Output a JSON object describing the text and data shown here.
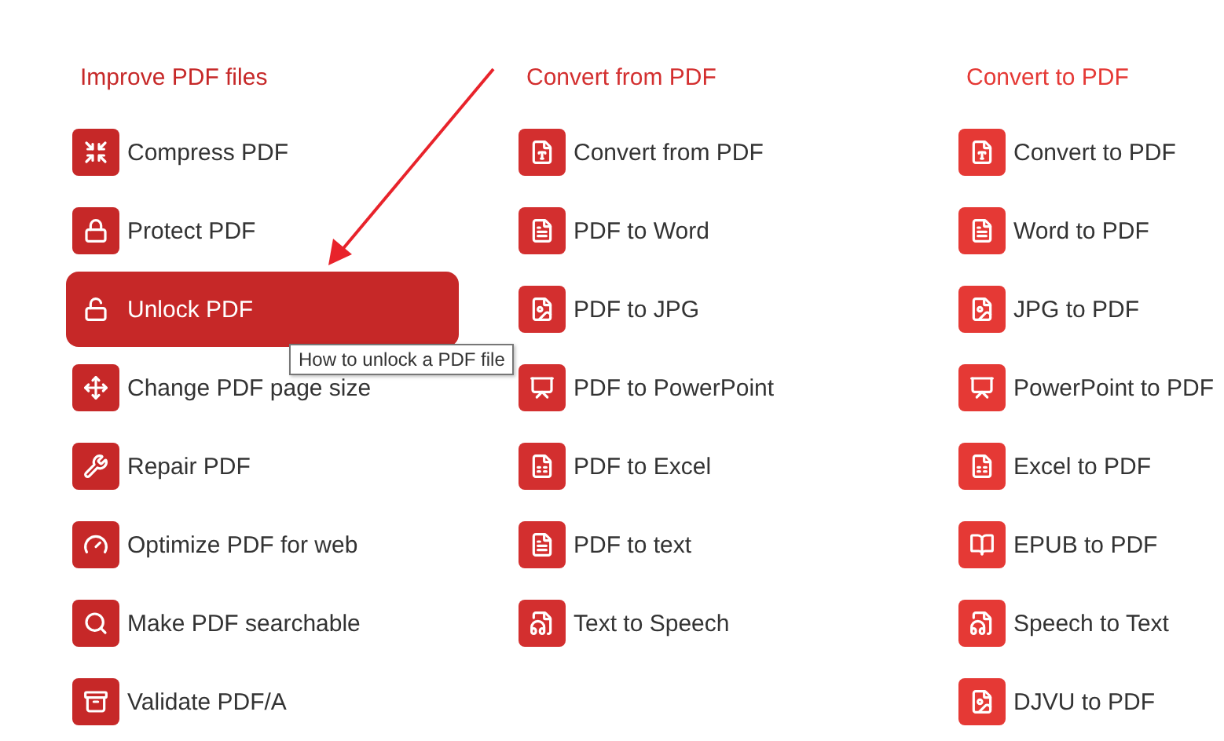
{
  "columns": [
    {
      "heading": "Improve PDF files",
      "color": "#c62828",
      "items": [
        {
          "label": "Compress PDF",
          "kind": "compress",
          "selected": false
        },
        {
          "label": "Protect PDF",
          "kind": "lock",
          "selected": false
        },
        {
          "label": "Unlock PDF",
          "kind": "unlock",
          "selected": true,
          "tooltip": "How to unlock a PDF file"
        },
        {
          "label": "Change PDF page size",
          "kind": "move",
          "selected": false
        },
        {
          "label": "Repair PDF",
          "kind": "wrench",
          "selected": false
        },
        {
          "label": "Optimize PDF for web",
          "kind": "gauge",
          "selected": false
        },
        {
          "label": "Make PDF searchable",
          "kind": "search",
          "selected": false
        },
        {
          "label": "Validate PDF/A",
          "kind": "archive",
          "selected": false
        }
      ]
    },
    {
      "heading": "Convert from PDF",
      "color": "#d32f2f",
      "items": [
        {
          "label": "Convert from PDF",
          "kind": "pdf",
          "selected": false
        },
        {
          "label": "PDF to Word",
          "kind": "word",
          "selected": false
        },
        {
          "label": "PDF to JPG",
          "kind": "image",
          "selected": false
        },
        {
          "label": "PDF to PowerPoint",
          "kind": "slides",
          "selected": false
        },
        {
          "label": "PDF to Excel",
          "kind": "sheet",
          "selected": false
        },
        {
          "label": "PDF to text",
          "kind": "text",
          "selected": false
        },
        {
          "label": "Text to Speech",
          "kind": "audio",
          "selected": false
        }
      ]
    },
    {
      "heading": "Convert to PDF",
      "color": "#e53935",
      "items": [
        {
          "label": "Convert to PDF",
          "kind": "pdf",
          "selected": false
        },
        {
          "label": "Word to PDF",
          "kind": "word",
          "selected": false
        },
        {
          "label": "JPG to PDF",
          "kind": "image",
          "selected": false
        },
        {
          "label": "PowerPoint to PDF",
          "kind": "slides",
          "selected": false
        },
        {
          "label": "Excel to PDF",
          "kind": "sheet",
          "selected": false
        },
        {
          "label": "EPUB to PDF",
          "kind": "book",
          "selected": false
        },
        {
          "label": "Speech to Text",
          "kind": "audio",
          "selected": false
        },
        {
          "label": "DJVU to PDF",
          "kind": "image",
          "selected": false
        }
      ]
    }
  ]
}
